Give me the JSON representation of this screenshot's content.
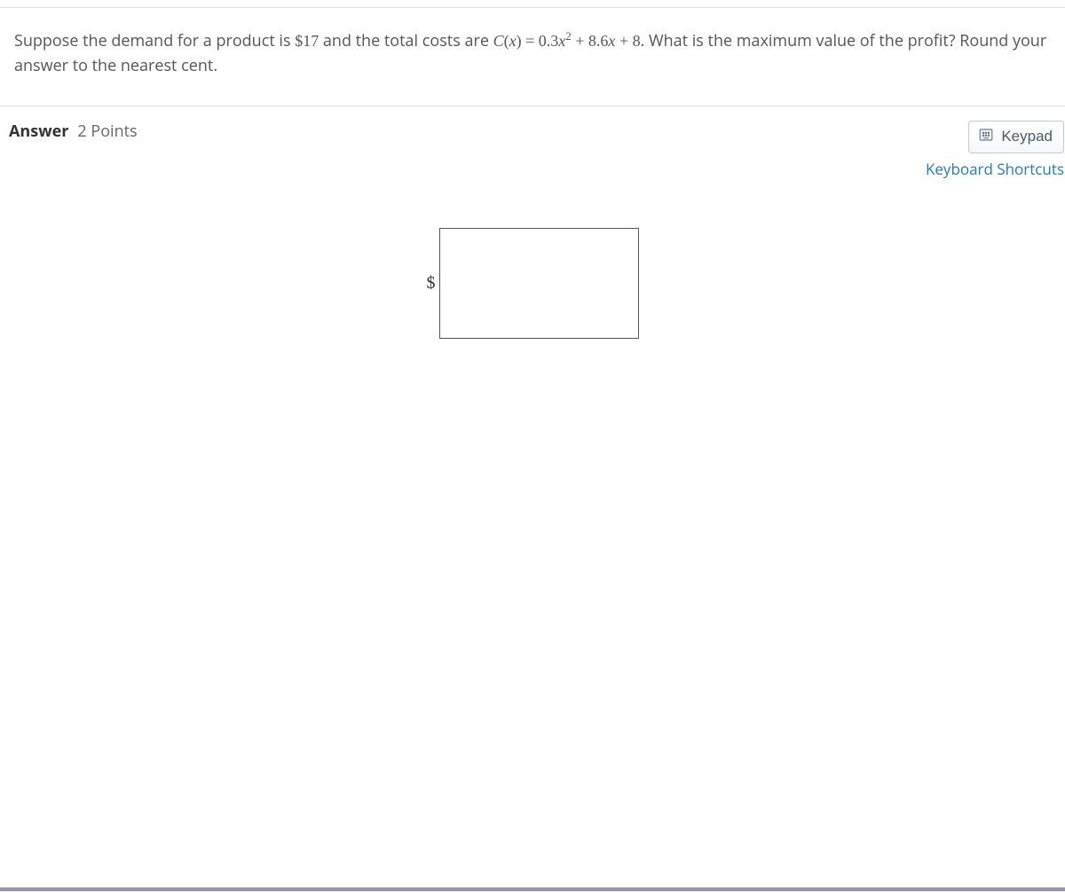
{
  "question": {
    "prefix": "Suppose the demand for a product is ",
    "price": "$17",
    "mid1": " and the total costs are ",
    "func_c": "C",
    "lpar": "(",
    "var_x": "x",
    "rpar": ")",
    "eq": " = ",
    "coef1": "0.3",
    "exp": "2",
    "plus1": " + ",
    "coef2": "8.6",
    "plus2": " + ",
    "const": "8",
    "suffix": ". What is the maximum value of the profit? Round your answer to the nearest cent."
  },
  "answer": {
    "label": "Answer",
    "points": "2 Points",
    "keypad": "Keypad",
    "shortcuts": "Keyboard Shortcuts",
    "currency": "$",
    "value": ""
  }
}
